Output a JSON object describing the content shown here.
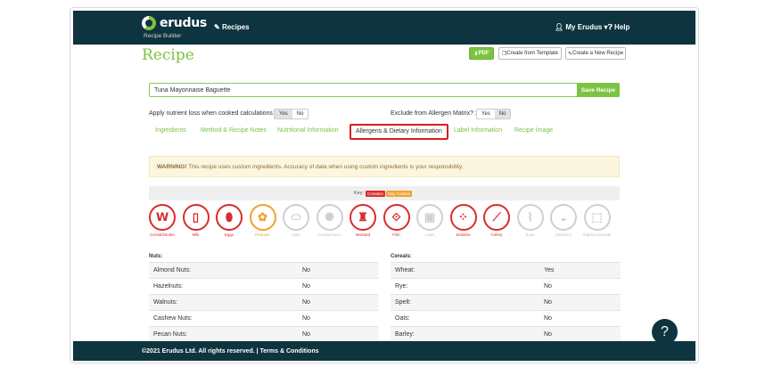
{
  "navbar": {
    "logo": "erudus",
    "logo_sub": "Recipe Builder",
    "recipes": "Recipes",
    "user": "My Erudus",
    "help": "Help"
  },
  "header": {
    "title": "Recipe",
    "pdf": "PDF",
    "create_template": "Create from Template",
    "create_new": "Create a New Recipe"
  },
  "recipe": {
    "name": "Tuna Mayonnaise Baguette",
    "save": "Save Recipe"
  },
  "options": {
    "nutrient_loss_label": "Apply nutrient loss when cooked calculations :",
    "exclude_label": "Exclude from Allergen Matrix? :",
    "yes": "Yes",
    "no": "No"
  },
  "tabs": [
    "Ingredients",
    "Method & Recipe Notes",
    "Nutritional Information",
    "Allergens & Dietary Information",
    "Label Information",
    "Recipe Image"
  ],
  "warning": {
    "strong": "WARNING!",
    "text": " This recipe uses custom ingredients. Accuracy of data when using custom ingredients is your responsibility."
  },
  "key": {
    "label": "Key:",
    "contains": "Contains",
    "may_contain": "May Contain",
    "contains_color": "#d82c2c",
    "may_contain_color": "#f0a22e"
  },
  "allergens": [
    {
      "name": "Cereal/Gluten",
      "status": "contains",
      "icon": "wheat-icon",
      "glyph": "𝗪"
    },
    {
      "name": "Milk",
      "status": "contains",
      "icon": "milk-icon",
      "glyph": "▯"
    },
    {
      "name": "Eggs",
      "status": "contains",
      "icon": "egg-icon",
      "glyph": "⬮"
    },
    {
      "name": "Peanuts",
      "status": "may-contain",
      "icon": "peanut-icon",
      "glyph": "✿"
    },
    {
      "name": "Nuts",
      "status": "absent",
      "icon": "nut-icon",
      "glyph": "⬭"
    },
    {
      "name": "Crustaceans",
      "status": "absent",
      "icon": "crab-icon",
      "glyph": "✺"
    },
    {
      "name": "Mustard",
      "status": "contains",
      "icon": "mustard-bottle-icon",
      "glyph": "♜"
    },
    {
      "name": "Fish",
      "status": "contains",
      "icon": "fish-icon",
      "glyph": "⟐"
    },
    {
      "name": "Lupin",
      "status": "absent",
      "icon": "lupin-icon",
      "glyph": "▣"
    },
    {
      "name": "Sesame",
      "status": "contains",
      "icon": "sesame-icon",
      "glyph": "⁘"
    },
    {
      "name": "Celery",
      "status": "contains",
      "icon": "celery-icon",
      "glyph": "⟋"
    },
    {
      "name": "Soya",
      "status": "absent",
      "icon": "soya-icon",
      "glyph": "⌇"
    },
    {
      "name": "Molluscs",
      "status": "absent",
      "icon": "mollusc-icon",
      "glyph": "◒"
    },
    {
      "name": "Sulphur Dioxide",
      "status": "absent",
      "icon": "sulphur-icon",
      "glyph": "⬚"
    }
  ],
  "nuts": {
    "title": "Nuts:",
    "rows": [
      {
        "name": "Almond Nuts:",
        "value": "No"
      },
      {
        "name": "Hazelnuts:",
        "value": "No"
      },
      {
        "name": "Walnuts:",
        "value": "No"
      },
      {
        "name": "Cashew Nuts:",
        "value": "No"
      },
      {
        "name": "Pecan Nuts:",
        "value": "No"
      }
    ]
  },
  "cereals": {
    "title": "Cereals:",
    "rows": [
      {
        "name": "Wheat:",
        "value": "Yes"
      },
      {
        "name": "Rye:",
        "value": "No"
      },
      {
        "name": "Spelt:",
        "value": "No"
      },
      {
        "name": "Oats:",
        "value": "No"
      },
      {
        "name": "Barley:",
        "value": "No"
      }
    ]
  },
  "footer": {
    "text": "©2021 Erudus Ltd. All rights reserved. | Terms & Conditions"
  },
  "help_fab": "?"
}
